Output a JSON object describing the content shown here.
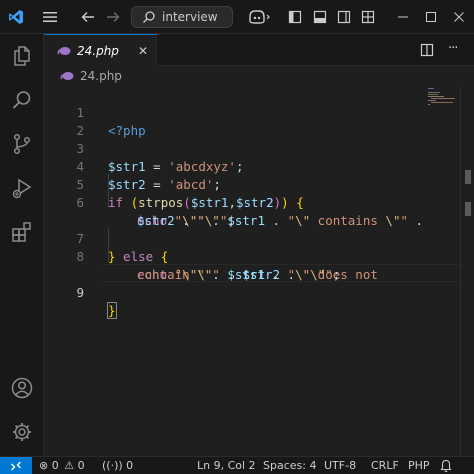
{
  "titlebar": {
    "search_text": "interview"
  },
  "tab": {
    "filename": "24.php"
  },
  "breadcrumb": {
    "filename": "24.php"
  },
  "editor": {
    "line_numbers": [
      "1",
      "2",
      "3",
      "4",
      "5",
      "6",
      "7",
      "8",
      "9"
    ],
    "lines": {
      "l1_open": "<?php",
      "l3_var": "$str1",
      "l3_eq": " = ",
      "l3_str": "'abcdxyz'",
      "l3_semi": ";",
      "l4_var": "$str2",
      "l4_eq": " = ",
      "l4_str": "'abcd'",
      "l4_semi": ";",
      "l5_if": "if",
      "l5_sp": " ",
      "l5_po": "(",
      "l5_fn": "strpos",
      "l5_p2o": "(",
      "l5_a1": "$str1",
      "l5_comma": ",",
      "l5_a2": "$str2",
      "l5_p2c": ")",
      "l5_pc": ")",
      "l5_sp2": " ",
      "l5_br": "{",
      "l6_echo": "echo",
      "l6_s1": " \"",
      "l6_e1": "\\\"",
      "l6_s1c": "\"",
      "l6_dot1": " . ",
      "l6_var": "$str1",
      "l6_dot2": " . ",
      "l6_s2": "\"",
      "l6_e2": "\\\"",
      "l6_s2b": " contains ",
      "l6_e3": "\\\"",
      "l6_s2c": "\"",
      "l6_dot3": " .",
      "l7_var": "$str2",
      "l7_dot": " . ",
      "l7_s": "\"",
      "l7_e": "\\\"",
      "l7_sc": "\"",
      "l7_semi": ";",
      "l8_brc": "}",
      "l8_else": " else ",
      "l8_bro": "{",
      "l8_echo": "echo",
      "l8_s1": " \"",
      "l8_e1": "\\\"",
      "l8_s1c": "\"",
      "l8_dot1": " . ",
      "l8_var": "$str1",
      "l8_dot2": " . ",
      "l8_s2": "\"",
      "l8_e2": "\\\"",
      "l8_s2b": " does not",
      "l9_s": "contain ",
      "l9_e": "\\\"",
      "l9_sc": "\"",
      "l9_dot1": " . ",
      "l9_var": "$str2",
      "l9_dot2": " . ",
      "l9_s2": "\"",
      "l9_e2": "\\\"",
      "l9_s2c": "\"",
      "l9_semi": ";",
      "l10_brc": "}"
    }
  },
  "statusbar": {
    "errors": "0",
    "warnings": "0",
    "ports": "0",
    "position": "Ln 9, Col 2",
    "spaces": "Spaces: 4",
    "encoding": "UTF-8",
    "eol": "CRLF",
    "language": "PHP"
  },
  "icons": {
    "vscode": "vscode-logo-icon",
    "menu": "hamburger-menu-icon",
    "back": "arrow-left-icon",
    "forward": "arrow-right-icon",
    "search": "search-icon",
    "copilot": "copilot-icon",
    "layout": "layout-icons",
    "explorer": "files-icon",
    "search_view": "search-icon",
    "scm": "source-control-icon",
    "debug": "run-debug-icon",
    "extensions": "extensions-icon",
    "account": "account-icon",
    "settings": "gear-icon",
    "php": "php-elephant-icon"
  },
  "colors": {
    "accent": "#0078d4",
    "php_icon": "#9d75c6"
  }
}
